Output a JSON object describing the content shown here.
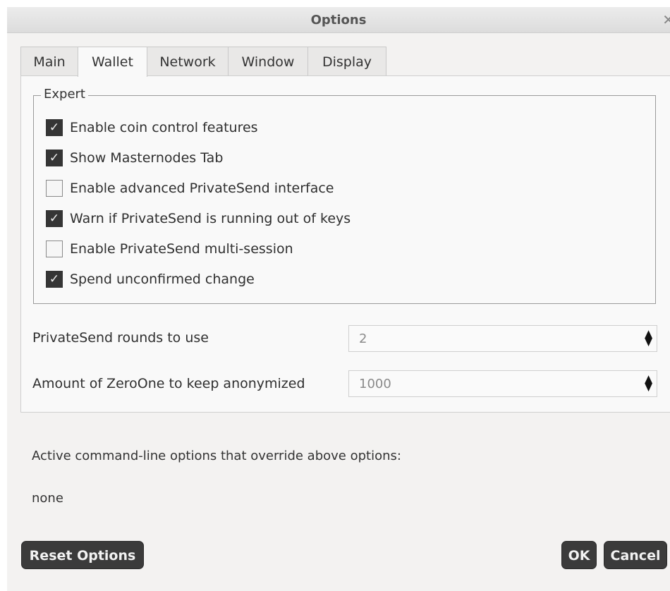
{
  "window": {
    "title": "Options"
  },
  "tabs": [
    {
      "label": "Main"
    },
    {
      "label": "Wallet"
    },
    {
      "label": "Network"
    },
    {
      "label": "Window"
    },
    {
      "label": "Display"
    }
  ],
  "expert": {
    "title": "Expert",
    "options": [
      {
        "label": "Enable coin control features",
        "checked": true
      },
      {
        "label": "Show Masternodes Tab",
        "checked": true
      },
      {
        "label": "Enable advanced PrivateSend interface",
        "checked": false
      },
      {
        "label": "Warn if PrivateSend is running out of keys",
        "checked": true
      },
      {
        "label": "Enable PrivateSend multi-session",
        "checked": false
      },
      {
        "label": "Spend unconfirmed change",
        "checked": true
      }
    ]
  },
  "privatesend_rounds": {
    "label": "PrivateSend rounds to use",
    "value": "2"
  },
  "anonymize_amount": {
    "label": "Amount of ZeroOne to keep anonymized",
    "value": "1000"
  },
  "overrides": {
    "label": "Active command-line options that override above options:",
    "value": "none"
  },
  "buttons": {
    "reset": "Reset Options",
    "ok": "OK",
    "cancel": "Cancel"
  },
  "icons": {
    "close": "close-icon",
    "check": "check-icon",
    "spin": "spin-arrows-icon"
  }
}
